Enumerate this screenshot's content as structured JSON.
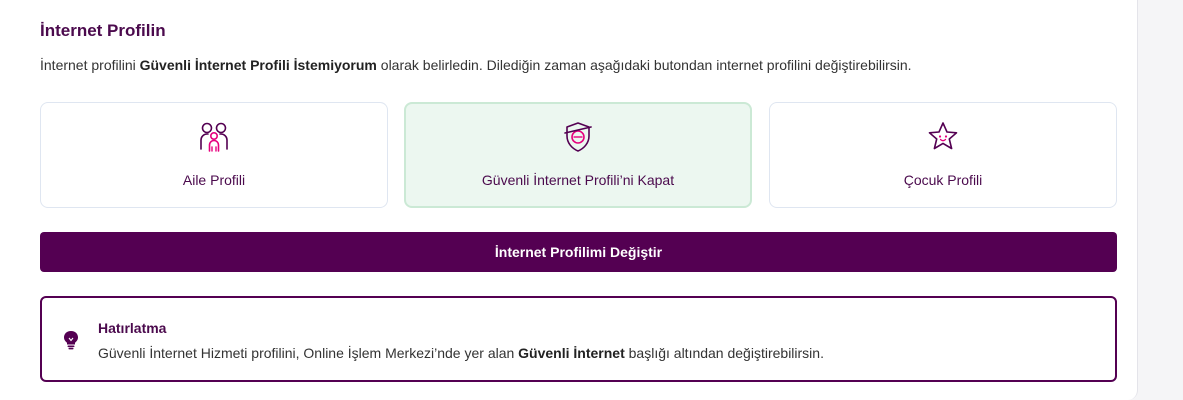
{
  "section": {
    "title": "İnternet Profilin",
    "description_prefix": "İnternet profilini ",
    "description_bold": "Güvenli İnternet Profili İstemiyorum",
    "description_suffix": " olarak belirledin. Dilediğin zaman aşağıdaki butondan internet profilini değiştirebilirsin."
  },
  "options": [
    {
      "label": "Aile Profili",
      "icon": "family-icon",
      "selected": false
    },
    {
      "label": "Güvenli İnternet Profili’ni Kapat",
      "icon": "shield-off-icon",
      "selected": true
    },
    {
      "label": "Çocuk Profili",
      "icon": "star-face-icon",
      "selected": false
    }
  ],
  "change_button": {
    "label": "İnternet Profilimi Değiştir"
  },
  "reminder": {
    "icon": "lightbulb-icon",
    "title": "Hatırlatma",
    "text_prefix": "Güvenli İnternet Hizmeti profilini, Online İşlem Merkezi’nde yer alan ",
    "text_bold": "Güvenli İnternet",
    "text_suffix": " başlığı altından değiştirebilirsin."
  },
  "colors": {
    "brand": "#540052",
    "accent_pink": "#e6007e",
    "selected_bg": "#ecf7f0",
    "selected_border": "#cbe9d5"
  }
}
